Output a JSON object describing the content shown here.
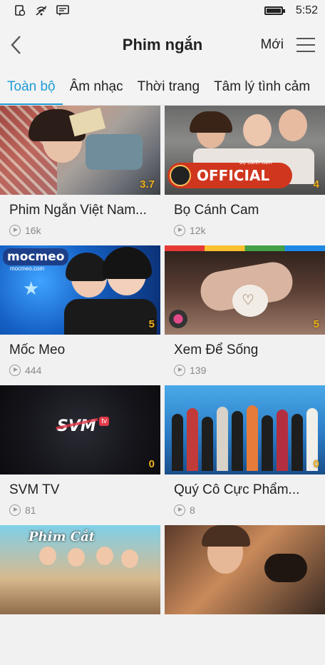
{
  "status": {
    "time": "5:52",
    "icons": [
      "alarm-icon",
      "wifi-icon",
      "message-icon",
      "battery-icon"
    ]
  },
  "header": {
    "title": "Phim ngắn",
    "new_label": "Mới",
    "back_icon": "chevron-left-icon",
    "menu_icon": "hamburger-icon"
  },
  "tabs": [
    {
      "label": "Toàn bộ",
      "active": true
    },
    {
      "label": "Âm nhạc"
    },
    {
      "label": "Thời trang"
    },
    {
      "label": "Tâm lý tình cảm"
    }
  ],
  "cards": [
    {
      "title": "Phim Ngắn Việt Nam...",
      "views": "16k",
      "score": "3.7"
    },
    {
      "title": "Bọ Cánh Cam",
      "views": "12k",
      "score": "4",
      "thumb_text": "OFFICIAL",
      "thumb_small": "bọ cánh cam"
    },
    {
      "title": "Mốc Meo",
      "views": "444",
      "score": "5",
      "thumb_text": "mocmeo",
      "thumb_small": "mocmeo.com"
    },
    {
      "title": "Xem Để Sống",
      "views": "139",
      "score": "5"
    },
    {
      "title": "SVM TV",
      "views": "81",
      "score": "0",
      "thumb_text": "SVM",
      "thumb_small": "tv"
    },
    {
      "title": "Quý Cô Cực Phẩm...",
      "views": "8",
      "score": "0"
    },
    {
      "title": "",
      "views": "",
      "score": "",
      "thumb_text": "Phim Cắt"
    },
    {
      "title": "",
      "views": "",
      "score": ""
    }
  ],
  "colors": {
    "accent": "#1e9bd7",
    "score": "#f2b21c"
  }
}
